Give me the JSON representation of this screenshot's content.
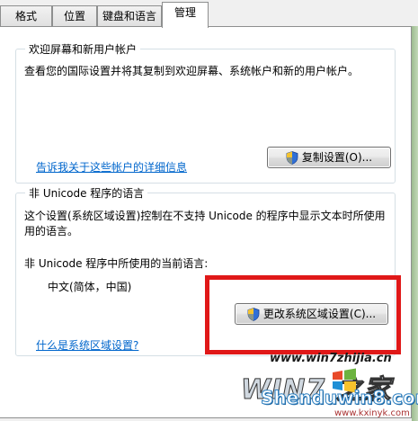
{
  "tabs": [
    "格式",
    "位置",
    "键盘和语言",
    "管理"
  ],
  "welcome_group": {
    "title": "欢迎屏幕和新用户帐户",
    "description": "查看您的国际设置并将其复制到欢迎屏幕、系统帐户和新的用户帐户。",
    "copy_button": "复制设置(O)...",
    "details_link": "告诉我关于这些帐户的详细信息"
  },
  "unicode_group": {
    "title": "非 Unicode 程序的语言",
    "description_line1": "这个设置(系统区域设置)控制在不支持 Unicode 的程序中显示文本时所使用",
    "description_line2": "用的语言。",
    "current_label": "非 Unicode 程序中所使用的当前语言:",
    "current_value": "中文(简体，中国)",
    "change_button": "更改系统区域设置(C)...",
    "what_link": "什么是系统区域设置?"
  },
  "watermarks": {
    "site1": "www.win7zhijia.cn",
    "win7_logo": "WIN7 之家",
    "site2": "Shenduwin8.com",
    "site3": "www.kxinyk.com"
  },
  "colors": {
    "highlight_border": "#e01818",
    "link": "#0066cc",
    "group_border": "#d5dfe5"
  }
}
